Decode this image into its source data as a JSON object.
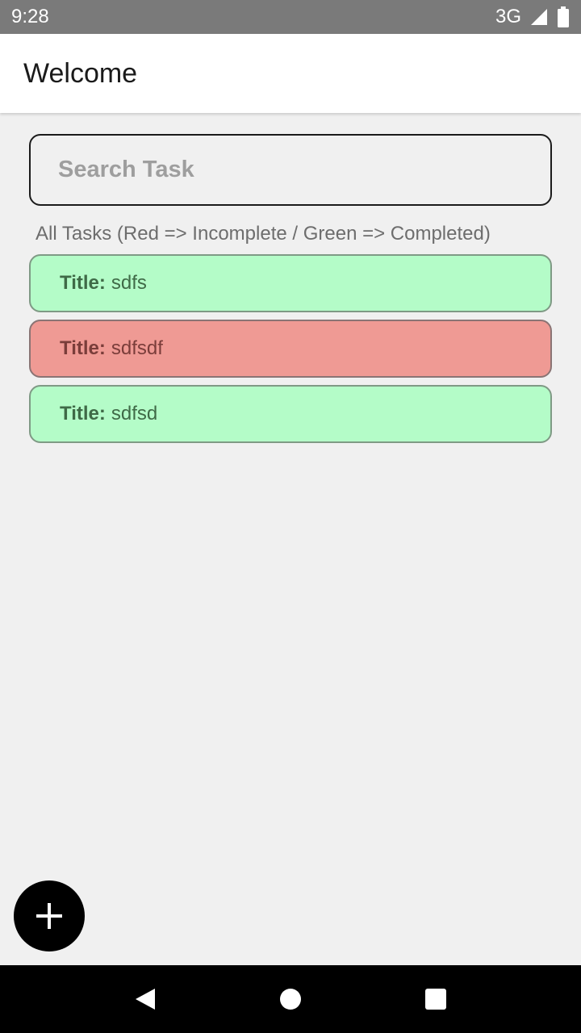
{
  "status_bar": {
    "time": "9:28",
    "network": "3G",
    "icons": [
      "signal-icon",
      "battery-icon"
    ]
  },
  "app_bar": {
    "title": "Welcome"
  },
  "search": {
    "placeholder": "Search Task",
    "value": ""
  },
  "section_label": "All Tasks (Red => Incomplete / Green => Completed)",
  "tasks": [
    {
      "label": "Title:",
      "title": "sdfs",
      "status": "completed"
    },
    {
      "label": "Title:",
      "title": "sdfsdf",
      "status": "incomplete"
    },
    {
      "label": "Title:",
      "title": "sdfsd",
      "status": "completed"
    }
  ],
  "colors": {
    "completed": "#b4fcc8",
    "incomplete": "#ef9a94",
    "fab": "#000000",
    "status_bar": "#7a7a7a"
  },
  "fab": {
    "icon": "plus-icon"
  },
  "nav_bar": {
    "icons": [
      "back-icon",
      "home-icon",
      "recents-icon"
    ]
  }
}
